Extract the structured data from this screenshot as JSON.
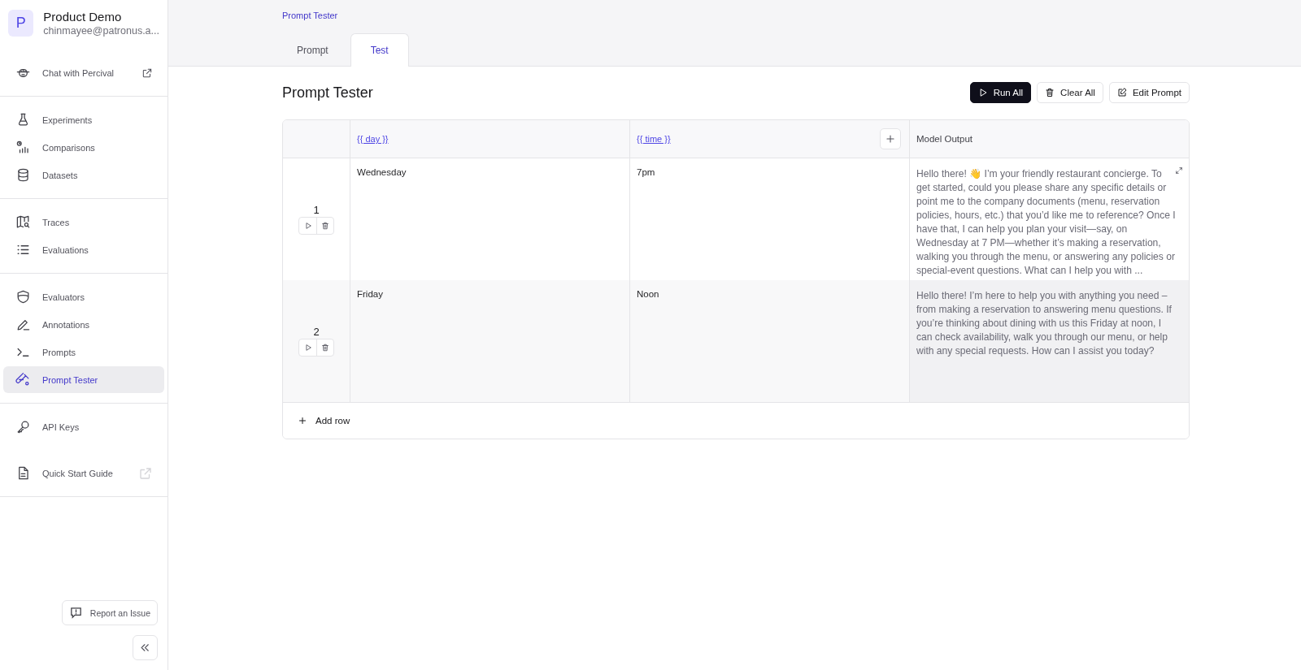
{
  "workspace": {
    "avatar": "P",
    "name": "Product Demo",
    "email": "chinmayee@patronus.a..."
  },
  "sidebar": {
    "sections": [
      {
        "items": [
          {
            "label": "Chat with Percival",
            "selected": false
          }
        ]
      },
      {
        "items": [
          {
            "label": "Experiments",
            "selected": false
          },
          {
            "label": "Comparisons",
            "selected": false
          },
          {
            "label": "Datasets",
            "selected": false
          }
        ]
      },
      {
        "items": [
          {
            "label": "Traces",
            "selected": false
          },
          {
            "label": "Evaluations",
            "selected": false
          }
        ]
      },
      {
        "items": [
          {
            "label": "Evaluators",
            "selected": false
          },
          {
            "label": "Annotations",
            "selected": false
          },
          {
            "label": "Prompts",
            "selected": false
          },
          {
            "label": "Prompt Tester",
            "selected": true
          }
        ]
      },
      {
        "items": [
          {
            "label": "API Keys",
            "selected": false
          }
        ]
      },
      {
        "items": [
          {
            "label": "Quick Start Guide",
            "selected": false
          }
        ]
      }
    ],
    "report": "Report an Issue"
  },
  "breadcrumb": "Prompt Tester",
  "tabs": [
    {
      "label": "Prompt",
      "selected": false
    },
    {
      "label": "Test",
      "selected": true
    }
  ],
  "title": "Prompt Tester",
  "actions": [
    {
      "kind": "run",
      "label": "Run All"
    },
    {
      "kind": "clear",
      "label": "Clear All"
    },
    {
      "kind": "edit",
      "label": "Edit Prompt"
    }
  ],
  "table": {
    "columns": [
      "{{ day }}",
      "{{ time }}"
    ],
    "output_column": "Model Output",
    "rows": [
      {
        "number": "1",
        "selected": false,
        "cells": [
          "Wednesday",
          "7pm"
        ],
        "output": "Hello there! 👋 I’m your friendly restaurant concierge. To get started, could you please share any specific details or point me to the company documents (menu, reservation policies, hours, etc.) that you’d like me to reference? Once I have that, I can help you plan your visit—say, on Wednesday at 7 PM—whether it’s making a reservation, walking you through the menu, or answering any policies or special-event questions. What can I help you with ..."
      },
      {
        "number": "2",
        "selected": true,
        "cells": [
          "Friday",
          "Noon"
        ],
        "output": "Hello there! I’m here to help you with anything you need – from making a reservation to answering menu questions. If you’re thinking about dining with us this Friday at noon, I can check availability, walk you through our menu, or help with any special requests. How can I assist you today?"
      }
    ],
    "add_row": "Add row"
  }
}
